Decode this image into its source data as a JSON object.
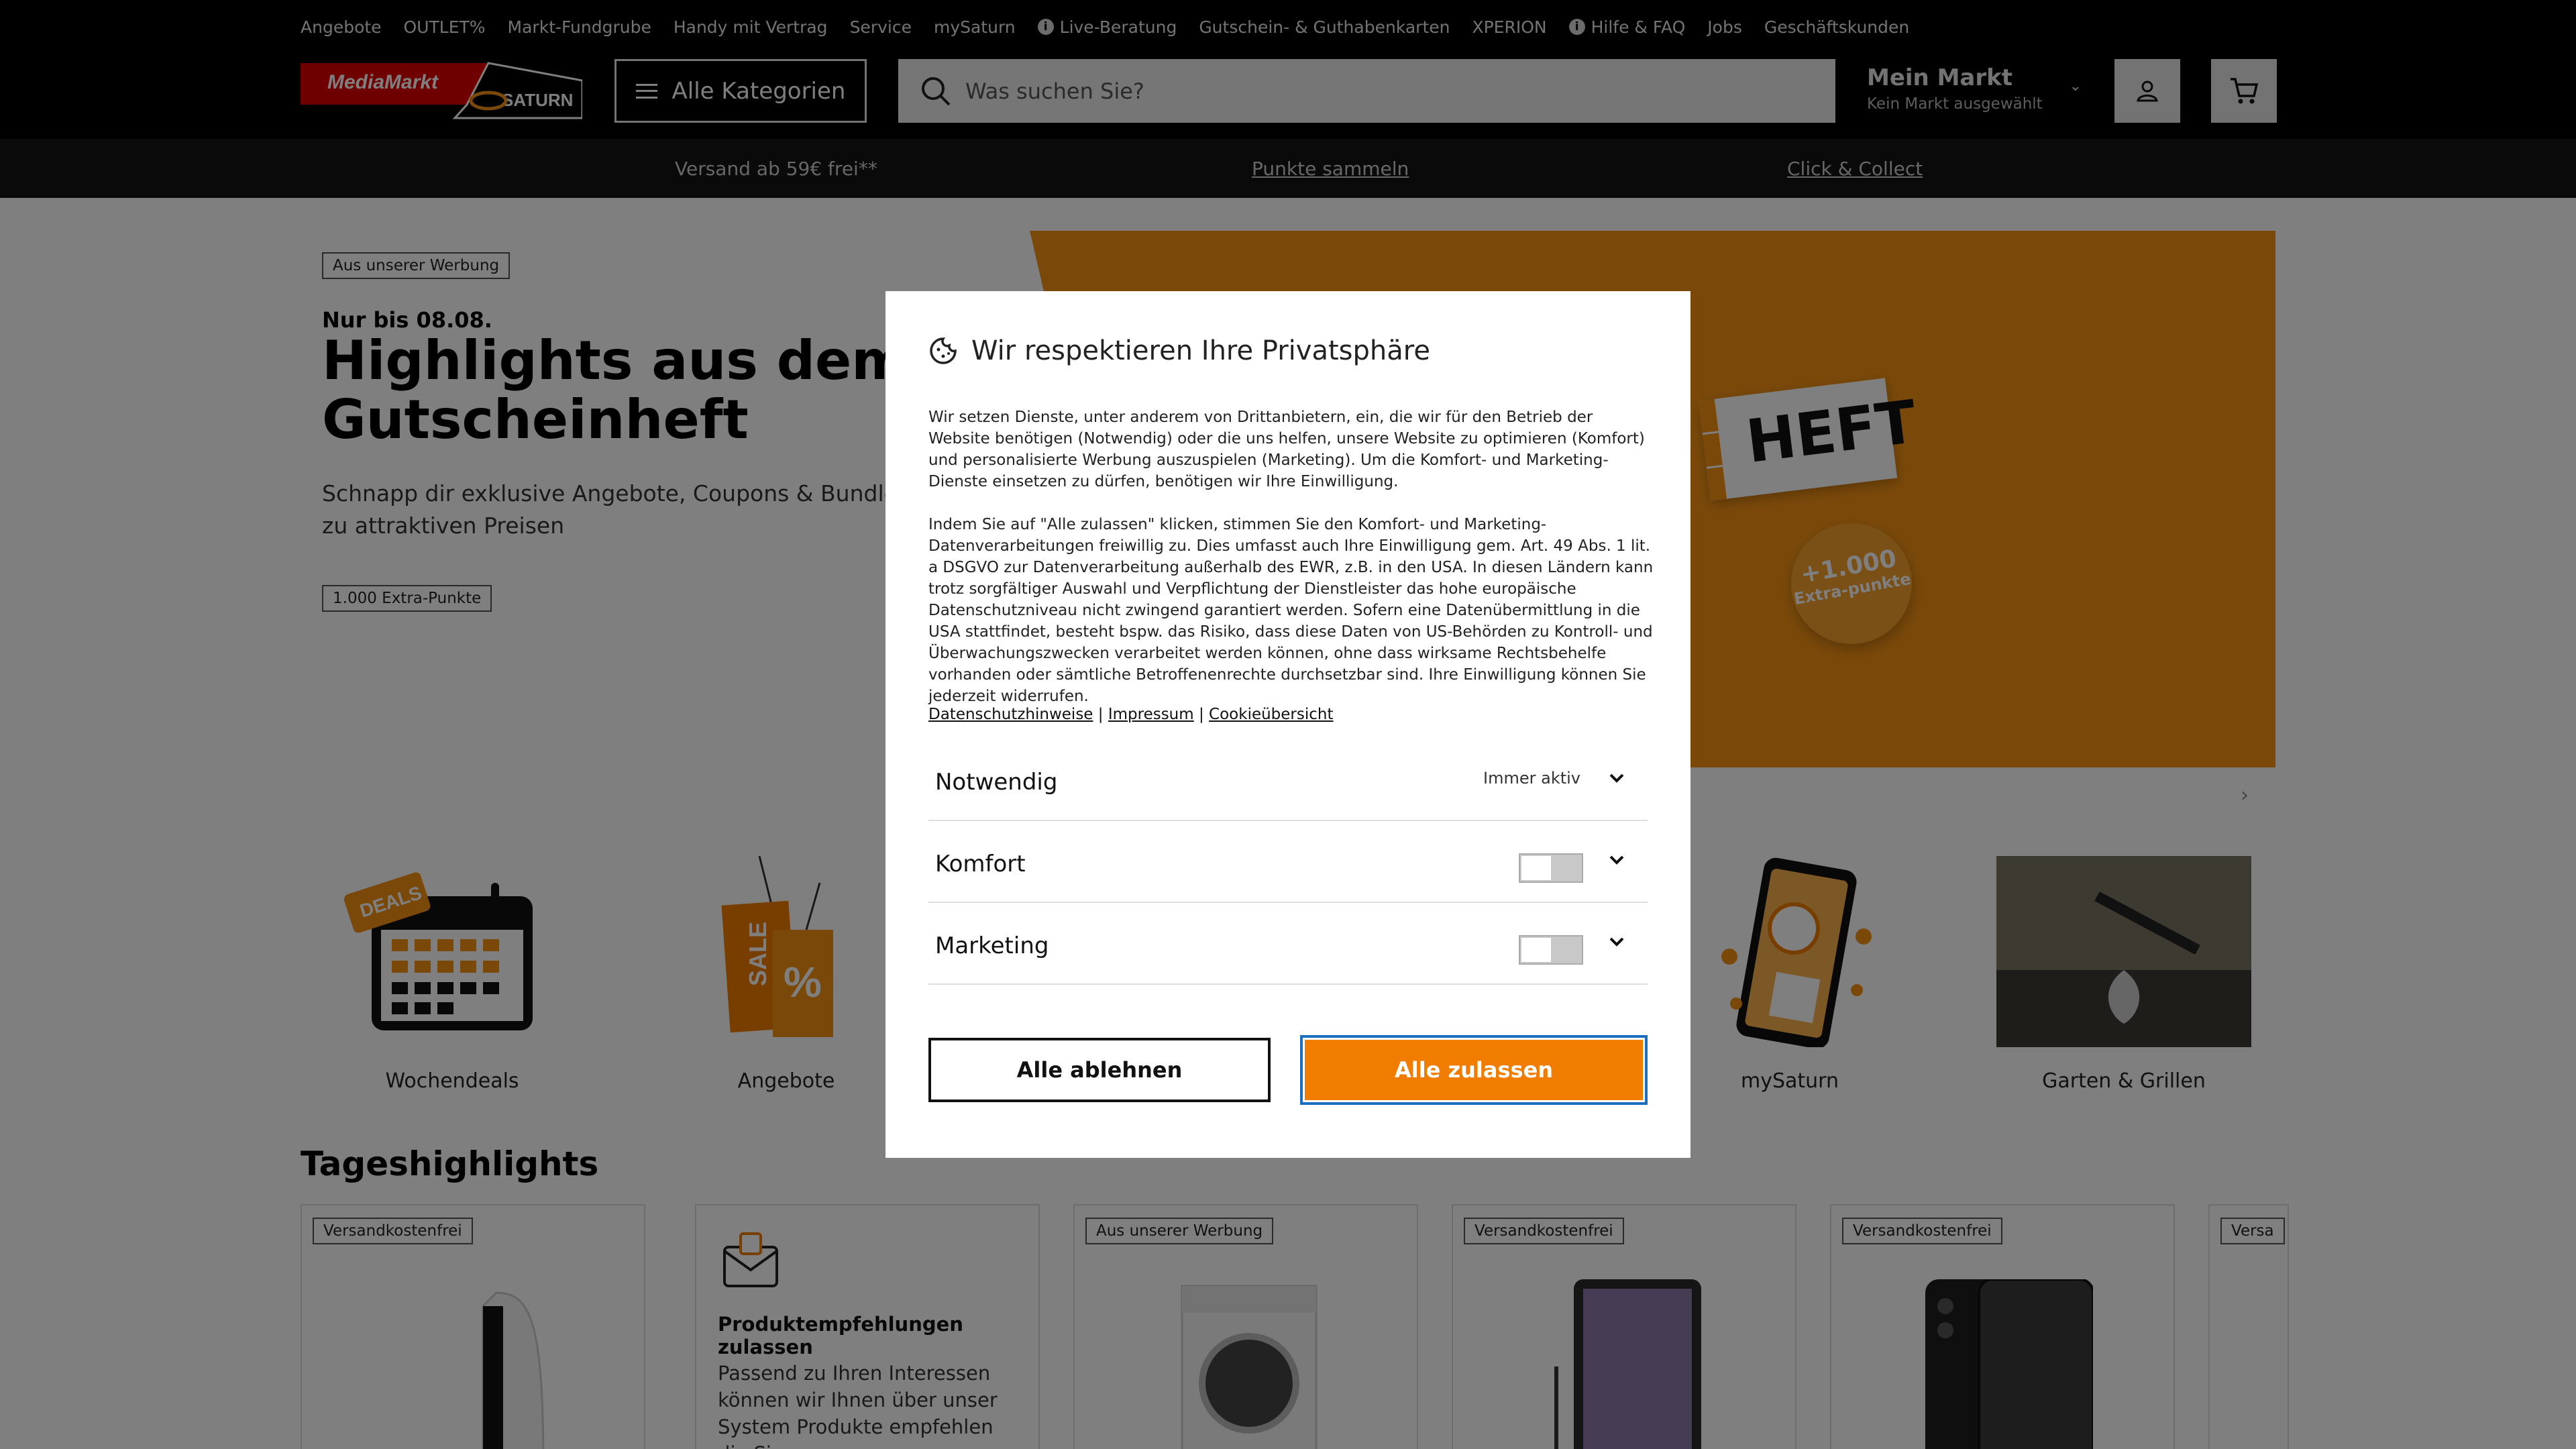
{
  "topnav": {
    "links": [
      "Angebote",
      "OUTLET%",
      "Markt-Fundgrube",
      "Handy mit Vertrag",
      "Service",
      "mySaturn",
      "Live-Beratung",
      "Gutschein- & Guthabenkarten",
      "XPERION",
      "Hilfe & FAQ",
      "Jobs",
      "Geschäftskunden"
    ]
  },
  "header": {
    "logo_text_1": "MediaMarkt",
    "logo_text_2": "SATURN",
    "all_categories": "Alle Kategorien",
    "search_placeholder": "Was suchen Sie?",
    "market_title": "Mein Markt",
    "market_sub": "Kein Markt ausgewählt"
  },
  "strip": {
    "shipping": "Versand ab 59€ frei**",
    "points": "Punkte sammeln",
    "click_collect": "Click & Collect"
  },
  "hero": {
    "ad_tag": "Aus unserer Werbung",
    "pretitle": "Nur bis 08.08.",
    "title": "Highlights aus dem Gutscheinheft",
    "subtitle": "Schnapp dir exklusive Angebote, Coupons & Bundles zu attraktiven Preisen",
    "points_tag": "1.000 Extra-Punkte",
    "heft_text": "HEFT",
    "badge_1": "+1.000",
    "badge_2": "Extra-punkte"
  },
  "categories": [
    "Wochendeals",
    "Angebote",
    "mySaturn",
    "Garten & Grillen"
  ],
  "cat_deals_tag": "DEALS",
  "cat_sale_tag": "SALE",
  "daily": {
    "title": "Tageshighlights",
    "cards": [
      {
        "tag": "Versandkostenfrei"
      },
      {
        "title": "Produktempfehlungen zulassen",
        "text": "Passend zu Ihren Interessen können wir Ihnen über unser System Produkte empfehlen die Sie"
      },
      {
        "tag": "Aus unserer Werbung"
      },
      {
        "tag": "Versandkostenfrei"
      },
      {
        "tag": "Versandkostenfrei"
      },
      {
        "tag": "Versa"
      }
    ]
  },
  "modal": {
    "title": "Wir respektieren Ihre Privatsphäre",
    "para1": "Wir setzen Dienste, unter anderem von Drittanbietern, ein, die wir für den Betrieb der Website benötigen (Notwendig) oder die uns helfen, unsere Website zu optimieren (Komfort) und personalisierte Werbung auszuspielen (Marketing). Um die Komfort- und Marketing-Dienste einsetzen zu dürfen, benötigen wir Ihre Einwilligung.",
    "para2": "Indem Sie auf \"Alle zulassen\" klicken, stimmen Sie den Komfort- und Marketing-Datenverarbeitungen freiwillig zu. Dies umfasst auch Ihre Einwilligung gem. Art. 49 Abs. 1 lit. a DSGVO zur Datenverarbeitung außerhalb des EWR, z.B. in den USA. In diesen Ländern kann trotz sorgfältiger Auswahl und Verpflichtung der Dienstleister das hohe europäische Datenschutzniveau nicht zwingend garantiert werden. Sofern eine Datenübermittlung in die USA stattfindet, besteht bspw. das Risiko, dass diese Daten von US-Behörden zu Kontroll- und Überwachungszwecken verarbeitet werden können, ohne dass wirksame Rechtsbehelfe vorhanden oder sämtliche Betroffenenrechte durchsetzbar sind. Ihre Einwilligung können Sie jederzeit widerrufen.",
    "link_privacy": "Datenschutzhinweise",
    "link_imprint": "Impressum",
    "link_cookies": "Cookieübersicht",
    "sep": "|",
    "row_necessary": "Notwendig",
    "always_active": "Immer aktiv",
    "row_comfort": "Komfort",
    "row_marketing": "Marketing",
    "reject": "Alle ablehnen",
    "accept": "Alle zulassen"
  }
}
